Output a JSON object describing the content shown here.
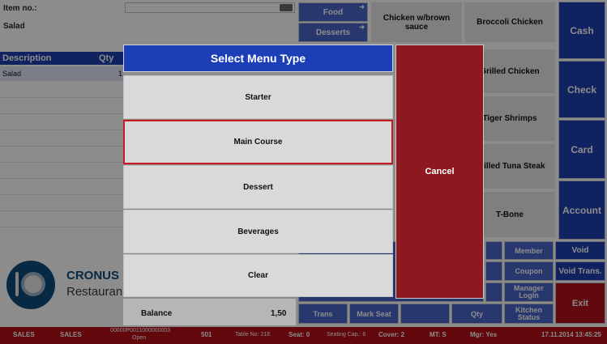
{
  "item_no_label": "Item no.:",
  "current_item": "Salad",
  "grid": {
    "headers": [
      "Description",
      "Qty"
    ],
    "rows": [
      {
        "description": "Salad",
        "qty": "1"
      }
    ]
  },
  "menu_tabs": [
    "Food",
    "Desserts"
  ],
  "menu_items": [
    "Chicken w/brown sauce",
    "Broccoli Chicken",
    "Grilled Chicken",
    "Tiger Shrimps",
    "Grilled Tuna Steak",
    "T-Bone"
  ],
  "pay_buttons": [
    "Cash",
    "Check",
    "Card",
    "Account"
  ],
  "bottom_grid": {
    "row1": [
      "Member",
      "Void"
    ],
    "row2": [
      "Coupon",
      "Void Trans."
    ],
    "row3": [
      "Manager Login"
    ],
    "row4": [
      "Trans",
      "Mark Seat",
      "Qty",
      "Kitchen Status",
      "Exit"
    ]
  },
  "logo": {
    "name": "CRONUS",
    "sub": "Restaurant"
  },
  "balance": {
    "label": "Balance",
    "value": "1,50"
  },
  "dialog": {
    "title": "Select Menu Type",
    "options": [
      "Starter",
      "Main Course",
      "Dessert",
      "Beverages",
      "Clear"
    ],
    "selected": "Main Course",
    "cancel": "Cancel"
  },
  "status_bar": {
    "s1": "SALES",
    "s2": "SALES",
    "order_no": "00000P0011000000003",
    "order_state": "Open",
    "table_code": "501",
    "table": "Table No: 21E",
    "seat": "Seat: 0",
    "seating_cap": "Seating Cap.: 6",
    "cover": "Cover: 2",
    "mt": "MT: S",
    "mgr": "Mgr: Yes",
    "datetime": "17.11.2014  13:45:25"
  },
  "colors": {
    "blue": "#1f3fb0",
    "red": "#b3121c",
    "grey": "#e8e8e8"
  }
}
